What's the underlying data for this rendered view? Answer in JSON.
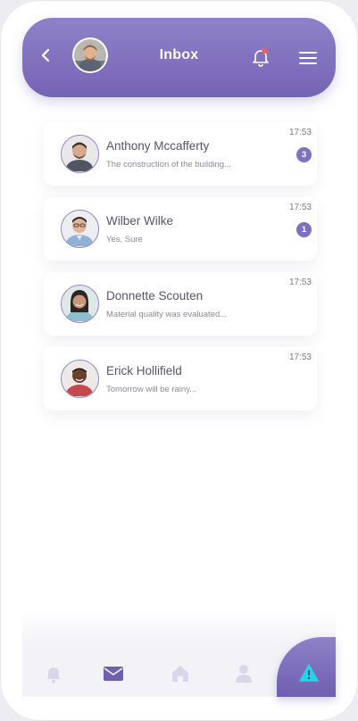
{
  "header": {
    "title": "Inbox",
    "icons": {
      "back": "chevron-left-icon",
      "bell": "bell-icon",
      "menu": "hamburger-menu-icon"
    },
    "notification_dot_color": "#ff5a5a"
  },
  "conversations": [
    {
      "name": "Anthony Mccafferty",
      "preview": "The construction of the building...",
      "time": "17:53",
      "unread": "3"
    },
    {
      "name": "Wilber Wilke",
      "preview": "Yes, Sure",
      "time": "17:53",
      "unread": "1"
    },
    {
      "name": "Donnette Scouten",
      "preview": "Material quality was evaluated...",
      "time": "17:53",
      "unread": ""
    },
    {
      "name": "Erick Hollifield",
      "preview": "Tomorrow will be rainy...",
      "time": "17:53",
      "unread": ""
    }
  ],
  "bottom_nav": {
    "items": [
      "bell-icon",
      "mail-icon",
      "home-icon",
      "user-icon"
    ],
    "active": "mail-icon",
    "fab_icon": "warning-triangle-icon"
  },
  "colors": {
    "accent": "#7f70c0",
    "header_gradient_top": "#8f81c9",
    "header_gradient_bottom": "#7564b4",
    "fab_icon_color": "#29d3e6"
  }
}
